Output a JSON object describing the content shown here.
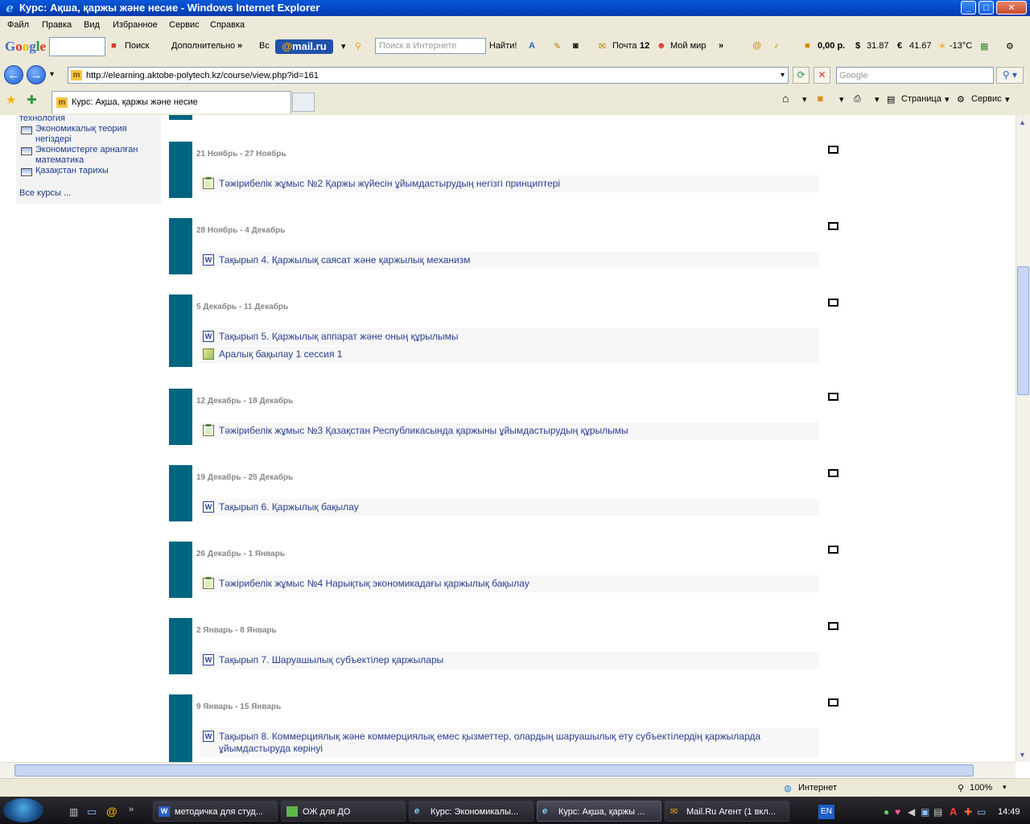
{
  "window": {
    "title": "Курс: Ақша, қаржы және несие - Windows Internet Explorer"
  },
  "menu": [
    "Файл",
    "Правка",
    "Вид",
    "Избранное",
    "Сервис",
    "Справка"
  ],
  "toolbar": {
    "search_label": "Поиск",
    "more_label": "Дополнительно",
    "more_arrow": "»",
    "vs_label": "Вс",
    "mailru_at": "@",
    "mailru_text": "mail.ru",
    "search_placeholder": "Поиск в Интернете",
    "find_label": "Найти!",
    "mail_label": "Почта",
    "mail_count": "12",
    "myworld_label": "Мой мир",
    "balance": "0,00 р.",
    "usd": "31.87",
    "eur": "41.67",
    "temp": "-13°C"
  },
  "address": {
    "url": "http://elearning.aktobe-polytech.kz/course/view.php?id=161",
    "search_placeholder": "Google"
  },
  "tabs": [
    {
      "label": "Курс: Ақша, қаржы және несие"
    }
  ],
  "commands": {
    "page": "Страница",
    "service": "Сервис"
  },
  "sidebar": {
    "items": [
      "технология",
      "Экономикалық теория негіздері",
      "Экономистерге арналған математика",
      "Қазақстан тарихы"
    ],
    "all_courses": "Все курсы ..."
  },
  "weeks": [
    {
      "dates": "21 Ноябрь - 27 Ноябрь",
      "activities": [
        {
          "icon": "assignment-icon",
          "text": "Тәжірибелік жұмыс №2 Қаржы жүйесін ұйымдастырудың негізгі принциптері"
        }
      ]
    },
    {
      "dates": "28 Ноябрь - 4 Декабрь",
      "activities": [
        {
          "icon": "word-doc-icon",
          "text": "Тақырып 4. Қаржылық саясат және қаржылық механизм"
        }
      ]
    },
    {
      "dates": "5 Декабрь - 11 Декабрь",
      "activities": [
        {
          "icon": "word-doc-icon",
          "text": "Тақырып 5. Қаржылық аппарат және оның құрылымы"
        },
        {
          "icon": "quiz-icon",
          "text": "Аралық бақылау 1 сессия 1"
        }
      ]
    },
    {
      "dates": "12 Декабрь - 18 Декабрь",
      "activities": [
        {
          "icon": "assignment-icon",
          "text": "Тәжірибелік жұмыс №3 Қазақстан Республикасында қаржыны ұйымдастырудың құрылымы"
        }
      ]
    },
    {
      "dates": "19 Декабрь - 25 Декабрь",
      "activities": [
        {
          "icon": "word-doc-icon",
          "text": "Тақырып 6. Қаржылық бақылау"
        }
      ]
    },
    {
      "dates": "26 Декабрь - 1 Январь",
      "activities": [
        {
          "icon": "assignment-icon",
          "text": "Тәжірибелік жұмыс №4 Нарықтық экономикадағы қаржылық бақылау"
        }
      ]
    },
    {
      "dates": "2 Январь - 8 Январь",
      "activities": [
        {
          "icon": "word-doc-icon",
          "text": "Тақырып 7. Шаруашылық субъектілер қаржылары"
        }
      ]
    },
    {
      "dates": "9 Январь - 15 Январь",
      "activities": [
        {
          "icon": "word-doc-icon",
          "text": "Тақырып 8. Коммерциялық және коммерциялық емес қызметтер, олардың шаруашылық ету субъектілердің қаржыларда ұйымдастыруда көрінуі"
        }
      ]
    }
  ],
  "status": {
    "zone": "Интернет",
    "zoom": "100%"
  },
  "taskbar": {
    "tasks": [
      "методичка для студ...",
      "ОЖ  для ДО",
      "Курс: Экономикалы...",
      "Курс: Ақша, қаржы ...",
      "Mail.Ru Агент (1 вкл..."
    ],
    "lang": "EN",
    "clock": "14:49"
  },
  "colors": {
    "week_bar": "#006680",
    "link": "#2a3f8f",
    "titlebar": "#0a58d8"
  }
}
